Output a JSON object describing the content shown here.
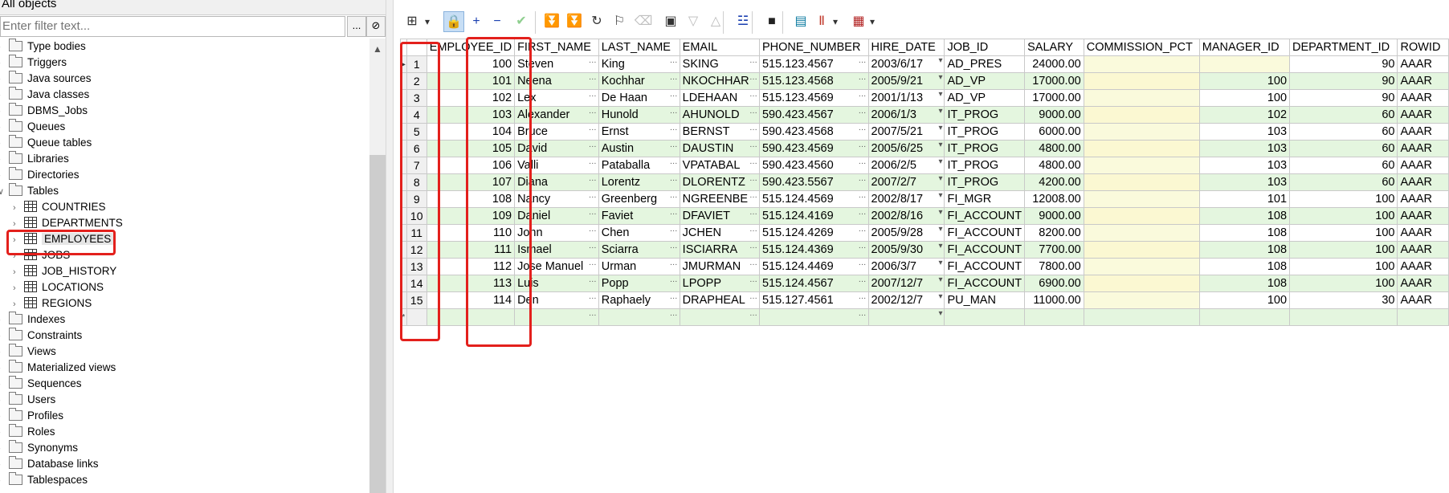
{
  "object_selector": {
    "label": "All objects"
  },
  "filter": {
    "placeholder": "Enter filter text..."
  },
  "filter_buttons": {
    "more": "...",
    "clear": "⊘"
  },
  "tree": {
    "items": [
      {
        "label": "Type bodies",
        "type": "folder",
        "level": 0,
        "expanded": false
      },
      {
        "label": "Triggers",
        "type": "folder",
        "level": 0,
        "expanded": false
      },
      {
        "label": "Java sources",
        "type": "folder",
        "level": 0,
        "expanded": false
      },
      {
        "label": "Java classes",
        "type": "folder",
        "level": 0,
        "expanded": false
      },
      {
        "label": "DBMS_Jobs",
        "type": "folder",
        "level": 0,
        "expanded": false
      },
      {
        "label": "Queues",
        "type": "folder",
        "level": 0,
        "expanded": false
      },
      {
        "label": "Queue tables",
        "type": "folder",
        "level": 0,
        "expanded": false
      },
      {
        "label": "Libraries",
        "type": "folder",
        "level": 0,
        "expanded": false
      },
      {
        "label": "Directories",
        "type": "folder",
        "level": 0,
        "expanded": false
      },
      {
        "label": "Tables",
        "type": "folder",
        "level": 0,
        "expanded": true
      },
      {
        "label": "COUNTRIES",
        "type": "table",
        "level": 1,
        "expanded": false
      },
      {
        "label": "DEPARTMENTS",
        "type": "table",
        "level": 1,
        "expanded": false
      },
      {
        "label": "EMPLOYEES",
        "type": "table",
        "level": 1,
        "expanded": false,
        "selected": true
      },
      {
        "label": "JOBS",
        "type": "table",
        "level": 1,
        "expanded": false
      },
      {
        "label": "JOB_HISTORY",
        "type": "table",
        "level": 1,
        "expanded": false
      },
      {
        "label": "LOCATIONS",
        "type": "table",
        "level": 1,
        "expanded": false
      },
      {
        "label": "REGIONS",
        "type": "table",
        "level": 1,
        "expanded": false
      },
      {
        "label": "Indexes",
        "type": "folder",
        "level": 0,
        "expanded": false
      },
      {
        "label": "Constraints",
        "type": "folder",
        "level": 0,
        "expanded": false
      },
      {
        "label": "Views",
        "type": "folder",
        "level": 0,
        "expanded": false
      },
      {
        "label": "Materialized views",
        "type": "folder",
        "level": 0,
        "expanded": false
      },
      {
        "label": "Sequences",
        "type": "folder",
        "level": 0,
        "expanded": false
      },
      {
        "label": "Users",
        "type": "folder",
        "level": 0,
        "expanded": false
      },
      {
        "label": "Profiles",
        "type": "folder",
        "level": 0,
        "expanded": false
      },
      {
        "label": "Roles",
        "type": "folder",
        "level": 0,
        "expanded": false
      },
      {
        "label": "Synonyms",
        "type": "folder",
        "level": 0,
        "expanded": false
      },
      {
        "label": "Database links",
        "type": "folder",
        "level": 0,
        "expanded": false
      },
      {
        "label": "Tablespaces",
        "type": "folder",
        "level": 0,
        "expanded": false
      }
    ]
  },
  "toolbar": {
    "buttons": [
      {
        "name": "grid-view-icon",
        "glyph": "⊞",
        "color": "#333333",
        "active": false
      },
      {
        "name": "dropdown-arrow-icon",
        "glyph": "▾",
        "color": "#333333",
        "active": false
      },
      {
        "name": "lock-icon",
        "glyph": "🔒",
        "color": "#333333",
        "active": true
      },
      {
        "name": "add-record-icon",
        "glyph": "+",
        "color": "#1a3fb0",
        "active": false
      },
      {
        "name": "delete-record-icon",
        "glyph": "−",
        "color": "#1a3fb0",
        "active": false
      },
      {
        "name": "post-changes-icon",
        "glyph": "✔",
        "color": "#8fcf8f",
        "active": false
      },
      {
        "name": "fetch-next-icon",
        "glyph": "⏬",
        "color": "#2a9a2a",
        "active": false
      },
      {
        "name": "fetch-last-icon",
        "glyph": "⏬",
        "color": "#2a9a2a",
        "active": false
      },
      {
        "name": "refresh-icon",
        "glyph": "↻",
        "color": "#333333",
        "active": false
      },
      {
        "name": "find-binoculars-icon",
        "glyph": "⚐",
        "color": "#333333",
        "active": false
      },
      {
        "name": "clear-eraser-icon",
        "glyph": "⌫",
        "color": "#c0c0c0",
        "active": false
      },
      {
        "name": "query-by-example-icon",
        "glyph": "▣",
        "color": "#333333",
        "active": false
      },
      {
        "name": "next-record-icon",
        "glyph": "▽",
        "color": "#bbbbbb",
        "active": false
      },
      {
        "name": "previous-record-icon",
        "glyph": "△",
        "color": "#bbbbbb",
        "active": false
      },
      {
        "name": "explain-plan-icon",
        "glyph": "☳",
        "color": "#1a3fb0",
        "active": false
      },
      {
        "name": "save-icon",
        "glyph": "■",
        "color": "#222222",
        "active": false
      },
      {
        "name": "export-icon",
        "glyph": "▤",
        "color": "#0a7aa0",
        "active": false
      },
      {
        "name": "chart-icon",
        "glyph": "Ⅱ",
        "color": "#c0392b",
        "active": false
      },
      {
        "name": "chart-dropdown-icon",
        "glyph": "▾",
        "color": "#333333",
        "active": false
      },
      {
        "name": "table-options-icon",
        "glyph": "▦",
        "color": "#b22222",
        "active": false
      },
      {
        "name": "table-options-dropdown-icon",
        "glyph": "▾",
        "color": "#333333",
        "active": false
      }
    ]
  },
  "grid": {
    "columns": [
      {
        "label": "",
        "key": "indicator"
      },
      {
        "label": "",
        "key": "rownum"
      },
      {
        "label": "EMPLOYEE_ID",
        "key": "employee_id",
        "align": "right"
      },
      {
        "label": "FIRST_NAME",
        "key": "first_name"
      },
      {
        "label": "LAST_NAME",
        "key": "last_name"
      },
      {
        "label": "EMAIL",
        "key": "email"
      },
      {
        "label": "PHONE_NUMBER",
        "key": "phone_number"
      },
      {
        "label": "HIRE_DATE",
        "key": "hire_date"
      },
      {
        "label": "JOB_ID",
        "key": "job_id"
      },
      {
        "label": "SALARY",
        "key": "salary",
        "align": "right"
      },
      {
        "label": "COMMISSION_PCT",
        "key": "commission_pct"
      },
      {
        "label": "MANAGER_ID",
        "key": "manager_id",
        "align": "right"
      },
      {
        "label": "DEPARTMENT_ID",
        "key": "department_id",
        "align": "right"
      },
      {
        "label": "ROWID",
        "key": "rowid"
      }
    ],
    "rows": [
      {
        "rownum": "1",
        "employee_id": "100",
        "first_name": "Steven",
        "last_name": "King",
        "email": "SKING",
        "phone_number": "515.123.4567",
        "hire_date": "2003/6/17",
        "job_id": "AD_PRES",
        "salary": "24000.00",
        "commission_pct": "",
        "manager_id": "",
        "department_id": "90",
        "rowid": "AAAR"
      },
      {
        "rownum": "2",
        "employee_id": "101",
        "first_name": "Neena",
        "last_name": "Kochhar",
        "email": "NKOCHHAR",
        "phone_number": "515.123.4568",
        "hire_date": "2005/9/21",
        "job_id": "AD_VP",
        "salary": "17000.00",
        "commission_pct": "",
        "manager_id": "100",
        "department_id": "90",
        "rowid": "AAAR"
      },
      {
        "rownum": "3",
        "employee_id": "102",
        "first_name": "Lex",
        "last_name": "De Haan",
        "email": "LDEHAAN",
        "phone_number": "515.123.4569",
        "hire_date": "2001/1/13",
        "job_id": "AD_VP",
        "salary": "17000.00",
        "commission_pct": "",
        "manager_id": "100",
        "department_id": "90",
        "rowid": "AAAR"
      },
      {
        "rownum": "4",
        "employee_id": "103",
        "first_name": "Alexander",
        "last_name": "Hunold",
        "email": "AHUNOLD",
        "phone_number": "590.423.4567",
        "hire_date": "2006/1/3",
        "job_id": "IT_PROG",
        "salary": "9000.00",
        "commission_pct": "",
        "manager_id": "102",
        "department_id": "60",
        "rowid": "AAAR"
      },
      {
        "rownum": "5",
        "employee_id": "104",
        "first_name": "Bruce",
        "last_name": "Ernst",
        "email": "BERNST",
        "phone_number": "590.423.4568",
        "hire_date": "2007/5/21",
        "job_id": "IT_PROG",
        "salary": "6000.00",
        "commission_pct": "",
        "manager_id": "103",
        "department_id": "60",
        "rowid": "AAAR"
      },
      {
        "rownum": "6",
        "employee_id": "105",
        "first_name": "David",
        "last_name": "Austin",
        "email": "DAUSTIN",
        "phone_number": "590.423.4569",
        "hire_date": "2005/6/25",
        "job_id": "IT_PROG",
        "salary": "4800.00",
        "commission_pct": "",
        "manager_id": "103",
        "department_id": "60",
        "rowid": "AAAR"
      },
      {
        "rownum": "7",
        "employee_id": "106",
        "first_name": "Valli",
        "last_name": "Pataballa",
        "email": "VPATABAL",
        "phone_number": "590.423.4560",
        "hire_date": "2006/2/5",
        "job_id": "IT_PROG",
        "salary": "4800.00",
        "commission_pct": "",
        "manager_id": "103",
        "department_id": "60",
        "rowid": "AAAR"
      },
      {
        "rownum": "8",
        "employee_id": "107",
        "first_name": "Diana",
        "last_name": "Lorentz",
        "email": "DLORENTZ",
        "phone_number": "590.423.5567",
        "hire_date": "2007/2/7",
        "job_id": "IT_PROG",
        "salary": "4200.00",
        "commission_pct": "",
        "manager_id": "103",
        "department_id": "60",
        "rowid": "AAAR"
      },
      {
        "rownum": "9",
        "employee_id": "108",
        "first_name": "Nancy",
        "last_name": "Greenberg",
        "email": "NGREENBE",
        "phone_number": "515.124.4569",
        "hire_date": "2002/8/17",
        "job_id": "FI_MGR",
        "salary": "12008.00",
        "commission_pct": "",
        "manager_id": "101",
        "department_id": "100",
        "rowid": "AAAR"
      },
      {
        "rownum": "10",
        "employee_id": "109",
        "first_name": "Daniel",
        "last_name": "Faviet",
        "email": "DFAVIET",
        "phone_number": "515.124.4169",
        "hire_date": "2002/8/16",
        "job_id": "FI_ACCOUNT",
        "salary": "9000.00",
        "commission_pct": "",
        "manager_id": "108",
        "department_id": "100",
        "rowid": "AAAR"
      },
      {
        "rownum": "11",
        "employee_id": "110",
        "first_name": "John",
        "last_name": "Chen",
        "email": "JCHEN",
        "phone_number": "515.124.4269",
        "hire_date": "2005/9/28",
        "job_id": "FI_ACCOUNT",
        "salary": "8200.00",
        "commission_pct": "",
        "manager_id": "108",
        "department_id": "100",
        "rowid": "AAAR"
      },
      {
        "rownum": "12",
        "employee_id": "111",
        "first_name": "Ismael",
        "last_name": "Sciarra",
        "email": "ISCIARRA",
        "phone_number": "515.124.4369",
        "hire_date": "2005/9/30",
        "job_id": "FI_ACCOUNT",
        "salary": "7700.00",
        "commission_pct": "",
        "manager_id": "108",
        "department_id": "100",
        "rowid": "AAAR"
      },
      {
        "rownum": "13",
        "employee_id": "112",
        "first_name": "Jose Manuel",
        "last_name": "Urman",
        "email": "JMURMAN",
        "phone_number": "515.124.4469",
        "hire_date": "2006/3/7",
        "job_id": "FI_ACCOUNT",
        "salary": "7800.00",
        "commission_pct": "",
        "manager_id": "108",
        "department_id": "100",
        "rowid": "AAAR"
      },
      {
        "rownum": "14",
        "employee_id": "113",
        "first_name": "Luis",
        "last_name": "Popp",
        "email": "LPOPP",
        "phone_number": "515.124.4567",
        "hire_date": "2007/12/7",
        "job_id": "FI_ACCOUNT",
        "salary": "6900.00",
        "commission_pct": "",
        "manager_id": "108",
        "department_id": "100",
        "rowid": "AAAR"
      },
      {
        "rownum": "15",
        "employee_id": "114",
        "first_name": "Den",
        "last_name": "Raphaely",
        "email": "DRAPHEAL",
        "phone_number": "515.127.4561",
        "hire_date": "2002/12/7",
        "job_id": "PU_MAN",
        "salary": "11000.00",
        "commission_pct": "",
        "manager_id": "100",
        "department_id": "30",
        "rowid": "AAAR"
      }
    ],
    "current_row_marker": "▸",
    "new_row_marker": "*",
    "ellipsis": "…",
    "dropdown_marker": "▾"
  },
  "colors": {
    "highlight_box": "#e3201c",
    "row_alt": "#e4f6df",
    "null_cell": "#fbf8d2"
  }
}
